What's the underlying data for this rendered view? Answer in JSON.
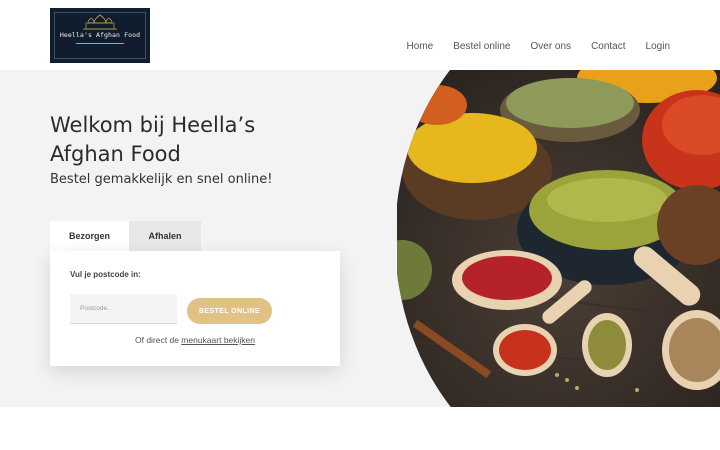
{
  "header": {
    "logo_text": "Heella's Afghan Food",
    "nav": [
      "Home",
      "Bestel online",
      "Over ons",
      "Contact",
      "Login"
    ]
  },
  "hero": {
    "title": "Welkom bij Heella’s Afghan Food",
    "subtitle": "Bestel gemakkelijk en snel online!"
  },
  "order": {
    "tabs": [
      "Bezorgen",
      "Afhalen"
    ],
    "active_tab": "Bezorgen",
    "postcode_label": "Vul je postcode in:",
    "postcode_placeholder": "Postcode..",
    "postcode_value": "",
    "button_label": "BESTEL ONLINE",
    "menu_prefix": "Of direct de",
    "menu_link": "menukaart bekijken"
  },
  "colors": {
    "accent": "#e2c184",
    "hero_bg": "#f3f3f5",
    "logo_bg": "#0f1d2e"
  },
  "icons": {
    "logo": "palace-dome-icon"
  }
}
